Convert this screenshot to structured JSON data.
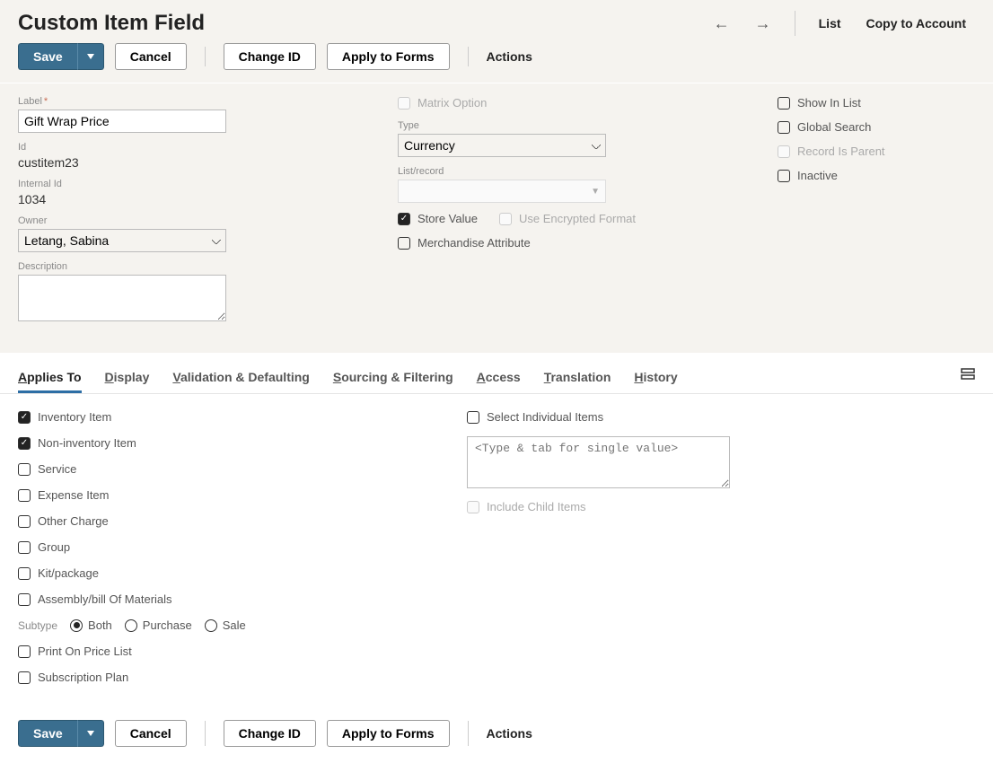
{
  "header": {
    "title": "Custom Item Field",
    "list": "List",
    "copy": "Copy to Account"
  },
  "toolbar": {
    "save": "Save",
    "cancel": "Cancel",
    "changeid": "Change ID",
    "apply": "Apply to Forms",
    "actions": "Actions"
  },
  "form": {
    "label_label": "Label",
    "label_value": "Gift Wrap Price",
    "id_label": "Id",
    "id_value": "custitem23",
    "internalid_label": "Internal Id",
    "internalid_value": "1034",
    "owner_label": "Owner",
    "owner_value": "Letang, Sabina",
    "description_label": "Description",
    "description_value": ""
  },
  "col2": {
    "matrix": "Matrix Option",
    "type_label": "Type",
    "type_value": "Currency",
    "listrec_label": "List/record",
    "store_value": "Store Value",
    "encrypted": "Use Encrypted Format",
    "merch": "Merchandise Attribute"
  },
  "col3": {
    "showinlist": "Show In List",
    "globalsearch": "Global Search",
    "recordisparent": "Record Is Parent",
    "inactive": "Inactive"
  },
  "tabs": {
    "appliesto": "pplies To",
    "appliesto_u": "A",
    "display": "isplay",
    "display_u": "D",
    "validation": "alidation & Defaulting",
    "validation_u": "V",
    "sourcing": "ourcing & Filtering",
    "sourcing_u": "S",
    "access": "ccess",
    "access_u": "A",
    "translation": "ranslation",
    "translation_u": "T",
    "history": "istory",
    "history_u": "H"
  },
  "applies": {
    "inventory": "Inventory Item",
    "noninventory": "Non-inventory Item",
    "service": "Service",
    "expense": "Expense Item",
    "other": "Other Charge",
    "group": "Group",
    "kit": "Kit/package",
    "assembly": "Assembly/bill Of Materials",
    "subtype_label": "Subtype",
    "subtype_both": "Both",
    "subtype_purchase": "Purchase",
    "subtype_sale": "Sale",
    "printonpricelist": "Print On Price List",
    "subscription": "Subscription Plan",
    "selectindividual": "Select Individual Items",
    "item_placeholder": "<Type & tab for single value>",
    "includechild": "Include Child Items"
  }
}
